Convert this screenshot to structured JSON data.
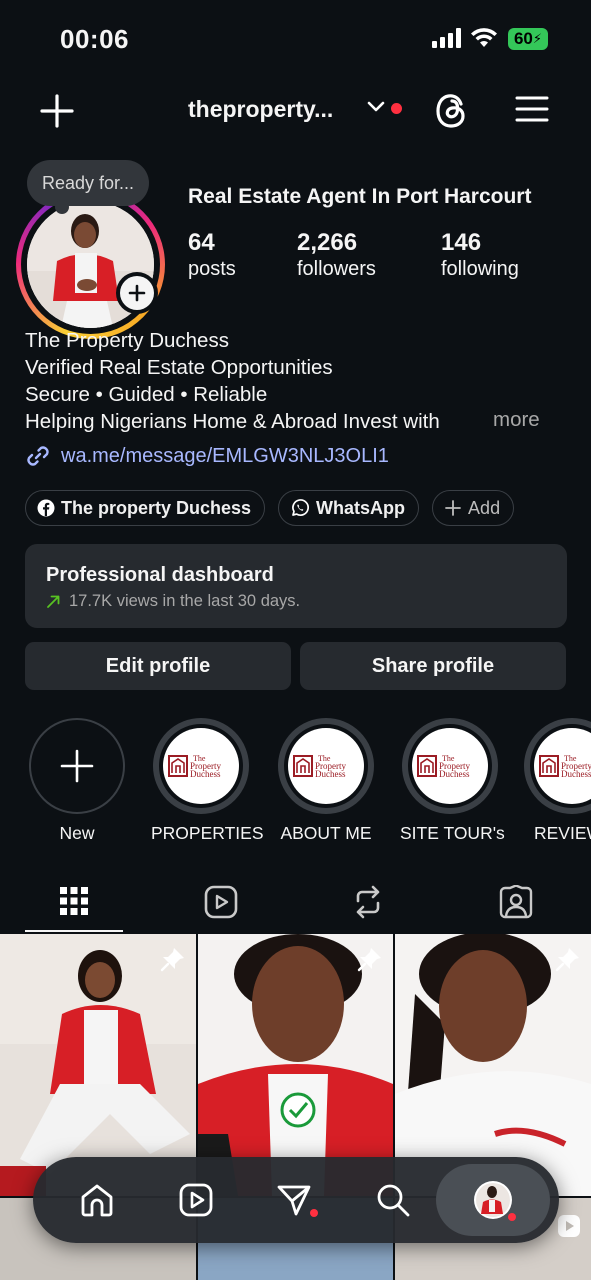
{
  "status_bar": {
    "time": "00:06",
    "battery": "60"
  },
  "header": {
    "username": "theproperty..."
  },
  "profile": {
    "note": "Ready for...",
    "category": "Real Estate Agent In Port Harcourt",
    "stats": [
      {
        "value": "64",
        "label": "posts"
      },
      {
        "value": "2,266",
        "label": "followers"
      },
      {
        "value": "146",
        "label": "following"
      }
    ],
    "bio_lines": [
      "The Property Duchess",
      "Verified Real Estate Opportunities",
      "Secure • Guided • Reliable",
      "Helping Nigerians Home & Abroad Invest with"
    ],
    "more_label": "more",
    "link": "wa.me/message/EMLGW3NLJ3OLI1"
  },
  "chips": [
    {
      "label": "The property Duchess",
      "icon": "facebook-icon"
    },
    {
      "label": "WhatsApp",
      "icon": "whatsapp-icon"
    },
    {
      "label": "Add",
      "icon": "plus-icon"
    }
  ],
  "dashboard": {
    "title": "Professional dashboard",
    "subtitle": "17.7K views in the last 30 days."
  },
  "actions": {
    "edit": "Edit profile",
    "share": "Share profile"
  },
  "highlights": [
    {
      "label": "New"
    },
    {
      "label": "PROPERTIES",
      "logo": [
        "The",
        "Property",
        "Duchess"
      ]
    },
    {
      "label": "ABOUT ME",
      "logo": [
        "The",
        "Property",
        "Duchess"
      ]
    },
    {
      "label": "SITE TOUR's",
      "logo": [
        "The",
        "Property",
        "Duchess"
      ]
    },
    {
      "label": "REVIEW",
      "logo": [
        "The",
        "Property",
        "Duchess"
      ]
    }
  ],
  "colors": {
    "background": "#0c1014",
    "surface": "#262a2f",
    "link": "#a8b8ff",
    "accent_red": "#ff3040",
    "battery": "#34c759"
  }
}
